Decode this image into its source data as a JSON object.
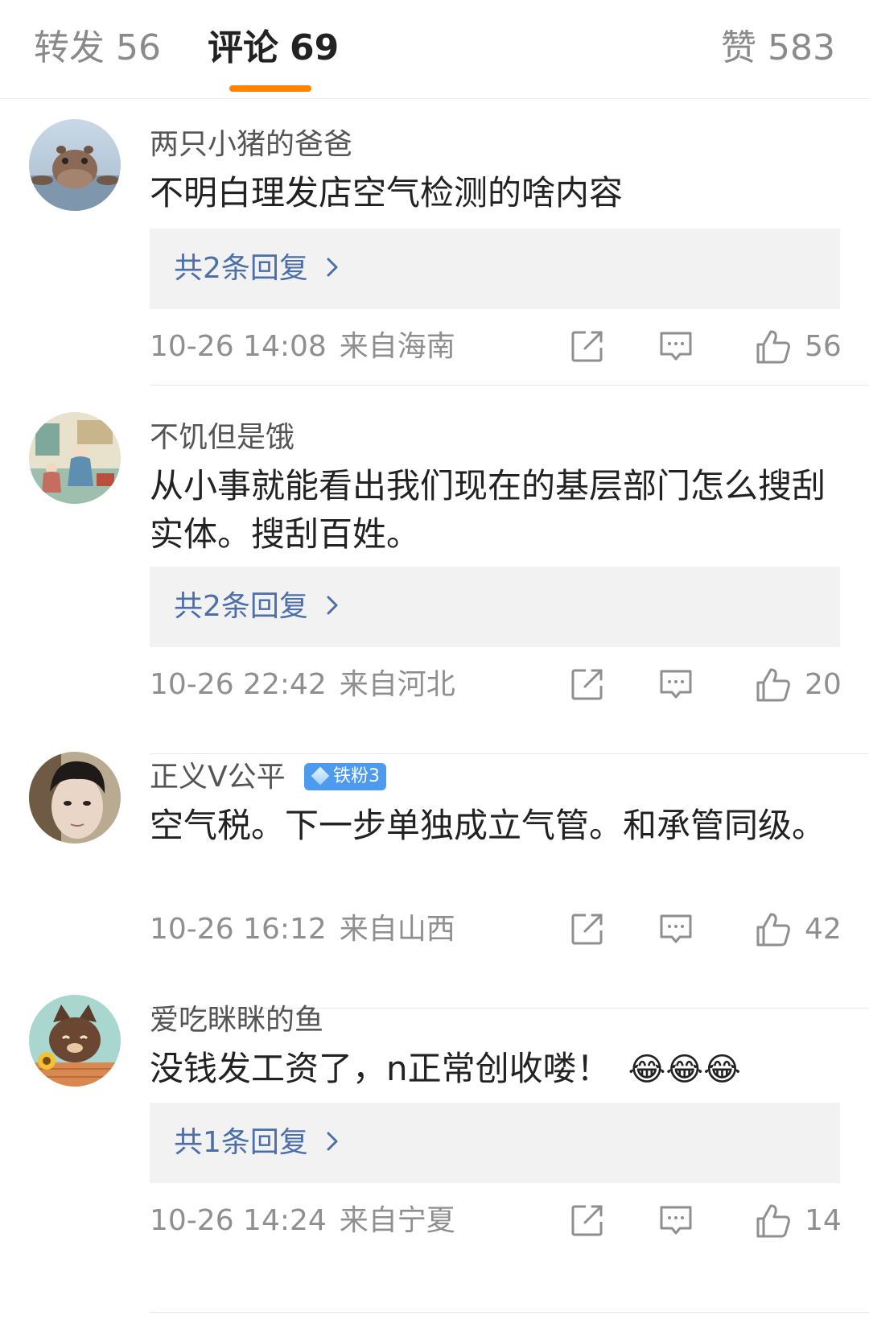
{
  "tabs": {
    "repost": {
      "label": "转发",
      "count": "56"
    },
    "comments": {
      "label": "评论",
      "count": "69"
    },
    "likes": {
      "label": "赞",
      "count": "583"
    }
  },
  "colors": {
    "accent": "#ff8200",
    "link": "#4c6faa",
    "badge": "#4c9bef"
  },
  "comments": [
    {
      "user": "两只小猪的爸爸",
      "text": "不明白理发店空气检测的啥内容",
      "replies": "共2条回复",
      "time": "10-26 14:08",
      "location": "来自海南",
      "likes": "56",
      "avatar": "hippo-avatar"
    },
    {
      "user": "不饥但是饿",
      "text": "从小事就能看出我们现在的基层部门怎么搜刮实体。搜刮百姓。",
      "replies": "共2条回复",
      "time": "10-26 22:42",
      "location": "来自河北",
      "likes": "20",
      "avatar": "painting-avatar"
    },
    {
      "user": "正义V公平",
      "badge": "铁粉3",
      "text": "空气税。下一步单独成立气管。和承管同级。",
      "time": "10-26 16:12",
      "location": "来自山西",
      "likes": "42",
      "avatar": "person-avatar"
    },
    {
      "user": "爱吃眯眯的鱼",
      "text": "没钱发工资了，n正常创收喽！",
      "emoji": "😂😂😂",
      "replies": "共1条回复",
      "time": "10-26 14:24",
      "location": "来自宁夏",
      "likes": "14",
      "avatar": "cat-avatar"
    }
  ],
  "icons": {
    "share": "share-icon",
    "comment": "comment-icon",
    "like": "thumbs-up-icon",
    "chevron": "chevron-right-icon"
  }
}
